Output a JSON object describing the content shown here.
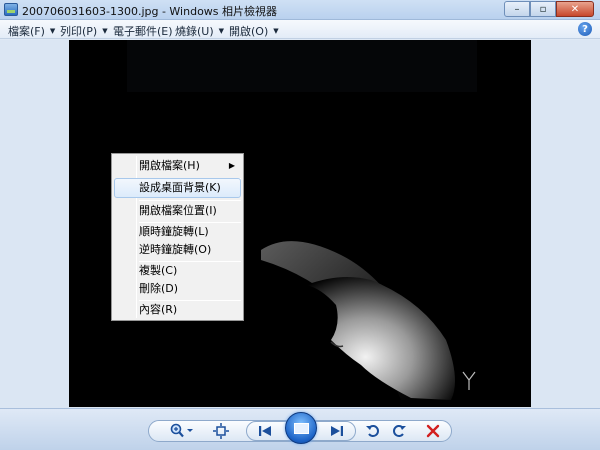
{
  "window": {
    "title": "200706031603-1300.jpg - Windows 相片檢視器",
    "controls": {
      "minimize": "–",
      "maximize": "▫",
      "close": "✕"
    }
  },
  "menubar": {
    "items": [
      {
        "label": "檔案(F)",
        "has_dropdown": true
      },
      {
        "label": "列印(P)",
        "has_dropdown": true
      },
      {
        "label": "電子郵件(E)",
        "has_dropdown": false
      },
      {
        "label": "燒錄(U)",
        "has_dropdown": true
      },
      {
        "label": "開啟(O)",
        "has_dropdown": true
      }
    ],
    "help_label": "?"
  },
  "context_menu": {
    "items": [
      {
        "label": "開啟檔案(H)",
        "submenu": true,
        "highlighted": false
      },
      {
        "label": "設成桌面背景(K)",
        "submenu": false,
        "highlighted": true
      },
      {
        "label": "開啟檔案位置(I)",
        "submenu": false,
        "highlighted": false
      },
      {
        "label": "順時鐘旋轉(L)",
        "submenu": false,
        "highlighted": false
      },
      {
        "label": "逆時鐘旋轉(O)",
        "submenu": false,
        "highlighted": false
      },
      {
        "label": "複製(C)",
        "submenu": false,
        "highlighted": false
      },
      {
        "label": "刪除(D)",
        "submenu": false,
        "highlighted": false
      },
      {
        "label": "內容(R)",
        "submenu": false,
        "highlighted": false
      }
    ],
    "submenu_arrow": "▶"
  },
  "toolbar": {
    "buttons": [
      {
        "name": "zoom-button",
        "icon": "magnifier-icon"
      },
      {
        "name": "actual-size-button",
        "icon": "fit-window-icon"
      },
      {
        "name": "previous-button",
        "icon": "previous-icon"
      },
      {
        "name": "slideshow-button",
        "icon": "slideshow-icon"
      },
      {
        "name": "next-button",
        "icon": "next-icon"
      },
      {
        "name": "rotate-counterclockwise-button",
        "icon": "rotate-ccw-icon"
      },
      {
        "name": "rotate-clockwise-button",
        "icon": "rotate-cw-icon"
      },
      {
        "name": "delete-button",
        "icon": "delete-icon"
      }
    ]
  },
  "colors": {
    "accent": "#1b62c6",
    "delete": "#d21f1f",
    "menu_highlight": "#dcebfb"
  }
}
